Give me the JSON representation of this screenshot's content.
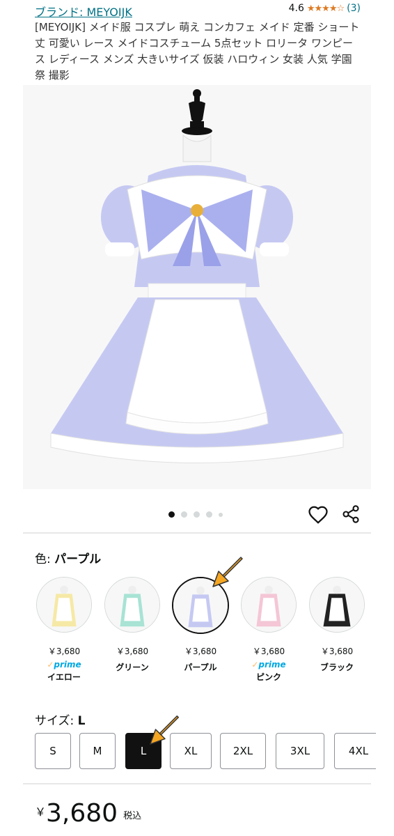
{
  "header": {
    "brand": "ブランド: MEYOIJK",
    "rating_value": "4.6",
    "rating_stars": 4.6,
    "rating_count": "(3)",
    "title": "[MEYOIJK] メイド服 コスプレ 萌え コンカフェ メイド 定番 ショート丈 可愛い レース メイドコスチューム 5点セット ロリータ ワンピース レディース メンズ 大きいサイズ 仮装 ハロウィン 女装 人気 学園祭 撮影"
  },
  "gallery": {
    "image_count": 5,
    "active_index": 0
  },
  "colors": {
    "label": "色: ",
    "selected_name": "パープル",
    "options": [
      {
        "name": "イエロー",
        "price": "￥3,680",
        "prime": true,
        "tint": "#f6e9a6"
      },
      {
        "name": "グリーン",
        "price": "￥3,680",
        "prime": false,
        "tint": "#a8e3d4"
      },
      {
        "name": "パープル",
        "price": "￥3,680",
        "prime": false,
        "tint": "#c5c9f2",
        "selected": true
      },
      {
        "name": "ピンク",
        "price": "￥3,680",
        "prime": true,
        "tint": "#f4c6d6"
      },
      {
        "name": "ブラック",
        "price": "￥3,680",
        "prime": false,
        "tint": "#222222"
      }
    ],
    "prime_label": "prime"
  },
  "sizes": {
    "label": "サイズ: ",
    "selected_name": "L",
    "options": [
      "S",
      "M",
      "L",
      "XL",
      "2XL",
      "3XL",
      "4XL"
    ],
    "selected_index": 2
  },
  "price": {
    "currency": "￥",
    "amount": "3,680",
    "tax_note": "税込"
  },
  "theme": {
    "link_color": "#007185",
    "star_color": "#de7921",
    "arrow_color": "#f5a623",
    "dress_color": "#c5c9f2"
  }
}
